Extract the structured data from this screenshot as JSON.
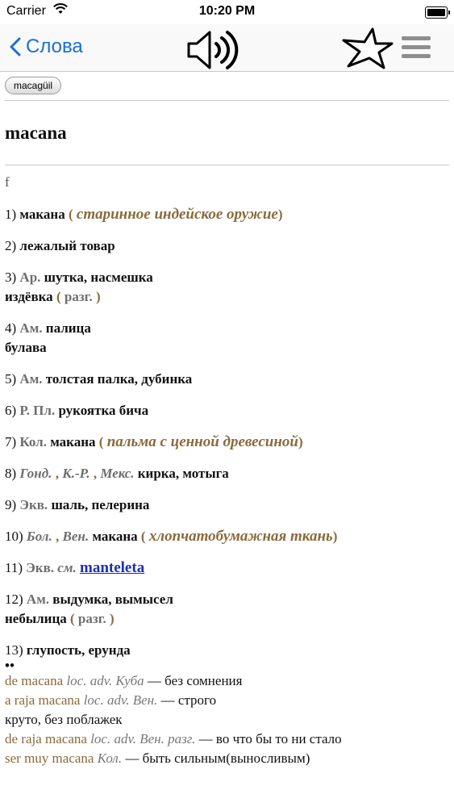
{
  "status": {
    "carrier": "Carrier",
    "time": "10:20 PM"
  },
  "nav": {
    "back_label": "Слова"
  },
  "chip": {
    "label": "macagüil"
  },
  "entry": {
    "headword": "macana",
    "gender": "f",
    "senses": [
      {
        "num": "1)",
        "tr": "макана",
        "note": "старинное индейское оружие"
      },
      {
        "num": "2)",
        "tr": "лежалый товар"
      },
      {
        "num": "3)",
        "label": "Ар.",
        "tr": "шутка, насмешка",
        "tr2": "издёвка",
        "note2": "разг."
      },
      {
        "num": "4)",
        "label": "Ам.",
        "tr": "палица",
        "tr2": "булава"
      },
      {
        "num": "5)",
        "label": "Ам.",
        "tr": "толстая палка, дубинка"
      },
      {
        "num": "6)",
        "label": "Р. Пл.",
        "tr": "рукоятка бича"
      },
      {
        "num": "7)",
        "label": "Кол.",
        "tr": "макана",
        "note": "пальма с ценной древесиной"
      },
      {
        "num": "8)",
        "ilabel1": "Гонд.",
        "ilabel2": "К.-Р.",
        "ilabel3": "Мекс.",
        "tr": "кирка, мотыга"
      },
      {
        "num": "9)",
        "label": "Экв.",
        "tr": "шаль, пелерина"
      },
      {
        "num": "10)",
        "ilabel1": "Бол.",
        "ilabel2": "Вен.",
        "tr": "макана",
        "note": "хлопчатобумажная ткань"
      },
      {
        "num": "11)",
        "label": "Экв.",
        "see": "см.",
        "link": "manteleta"
      },
      {
        "num": "12)",
        "label": "Ам.",
        "tr": "выдумка, вымысел",
        "tr2": "небылица",
        "note2": "разг."
      },
      {
        "num": "13)",
        "tr": "глупость, ерунда"
      }
    ],
    "bullet": "••",
    "phrases": [
      {
        "ph": "de macana",
        "lab": "loc. adv. Куба",
        "tr": "— без сомнения"
      },
      {
        "ph": "a raja macana",
        "lab": "loc. adv. Вен.",
        "tr": "— строго"
      },
      {
        "ph": "",
        "lab": "",
        "tr": "круто, без поблажек"
      },
      {
        "ph": "de raja macana",
        "lab": "loc. adv. Вен. разг.",
        "tr": "— во что бы то ни стало"
      },
      {
        "ph": "ser muy macana",
        "lab": "Кол.",
        "tr": "— быть сильным(выносливым)"
      }
    ]
  }
}
